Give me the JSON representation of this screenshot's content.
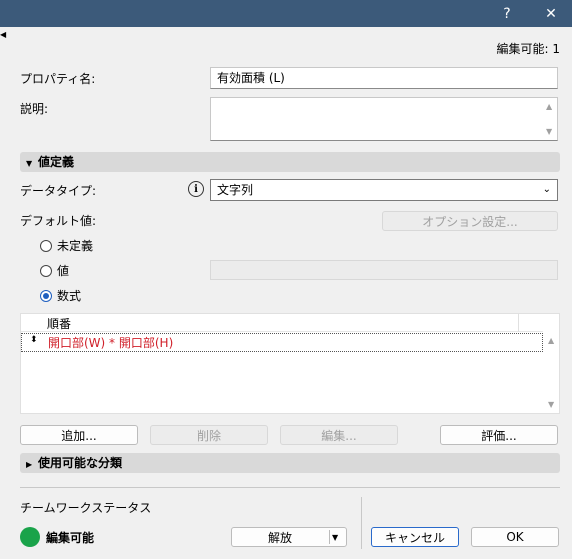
{
  "window": {
    "help_label": "?",
    "close_label": "✕",
    "edit_status": "編集可能: 1"
  },
  "property": {
    "name_label": "プロパティ名:",
    "name_value": "有効面積 (L)",
    "description_label": "説明:",
    "description_value": ""
  },
  "value_definition": {
    "section_label": "値定義",
    "data_type_label": "データタイプ:",
    "data_type_value": "文字列",
    "default_label": "デフォルト値:",
    "options_button": "オプション設定...",
    "radio_undefined": "未定義",
    "radio_value": "値",
    "radio_formula": "数式",
    "value_field": "",
    "table_header": "順番",
    "formula_rows": [
      "開口部(W) * 開口部(H)"
    ],
    "formula_color": "#d0202a"
  },
  "list_buttons": {
    "add": "追加...",
    "delete": "削除",
    "edit": "編集...",
    "evaluate": "評価..."
  },
  "classification": {
    "section_label": "使用可能な分類"
  },
  "teamwork": {
    "label": "チームワークステータス",
    "status": "編集可能",
    "status_color": "#1aa34a",
    "release_button": "解放"
  },
  "dialog_buttons": {
    "cancel": "キャンセル",
    "ok": "OK"
  }
}
